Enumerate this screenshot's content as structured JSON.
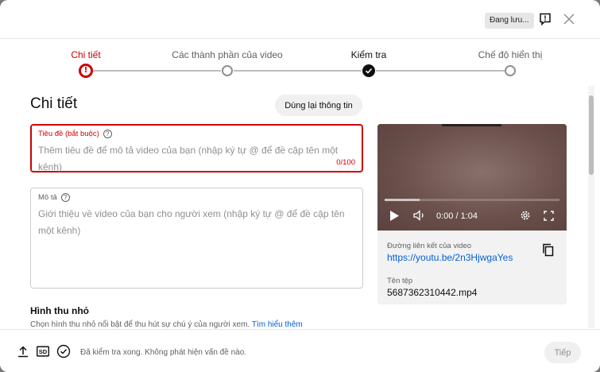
{
  "header": {
    "saving_status": "Đang lưu...",
    "feedback_icon": "feedback-icon",
    "close_icon": "close-icon"
  },
  "stepper": {
    "steps": [
      {
        "label": "Chi tiết",
        "state": "error"
      },
      {
        "label": "Các thành phần của video",
        "state": "pending"
      },
      {
        "label": "Kiểm tra",
        "state": "done"
      },
      {
        "label": "Chế độ hiển thị",
        "state": "pending"
      }
    ]
  },
  "main": {
    "title": "Chi tiết",
    "reuse_button": "Dùng lại thông tin",
    "title_field": {
      "label": "Tiêu đề (bắt buộc)",
      "placeholder": "Thêm tiêu đề để mô tả video của bạn (nhập ký tự @ để đề cập tên một kênh)",
      "counter": "0/100"
    },
    "description_field": {
      "label": "Mô tả",
      "placeholder": "Giới thiệu về video của bạn cho người xem (nhập ký tự @ để đề cập tên một kênh)"
    },
    "thumbnail": {
      "title": "Hình thu nhỏ",
      "description": "Chọn hình thu nhỏ nổi bật để thu hút sự chú ý của người xem.",
      "learn_more": "Tìm hiểu thêm"
    }
  },
  "preview": {
    "time": "0:00 / 1:04",
    "progress": 0.2,
    "link_label": "Đường liên kết của video",
    "link": "https://youtu.be/2n3HjwgaYes",
    "filename_label": "Tên tệp",
    "filename": "5687362310442.mp4"
  },
  "footer": {
    "status": "Đã kiểm tra xong. Không phát hiện vấn đề nào.",
    "sd_badge": "SD",
    "next_button": "Tiếp"
  },
  "colors": {
    "error": "#cc0000",
    "link": "#065fd4"
  }
}
